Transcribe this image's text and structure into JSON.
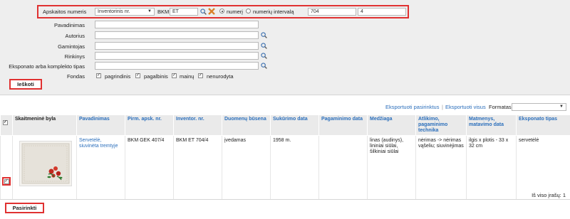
{
  "search": {
    "inventory_label": "Apskaitos numeris",
    "type_select": "Inventorinis nr.",
    "bkm_label": "BKM",
    "prefix_value": "ET",
    "radio_single": "numerį",
    "radio_interval": "numerių intervalą",
    "from_value": "704",
    "to_value": "4"
  },
  "filters": [
    {
      "label": "Pavadinimas",
      "icon": false
    },
    {
      "label": "Autorius",
      "icon": true
    },
    {
      "label": "Gamintojas",
      "icon": true
    },
    {
      "label": "Rinkinys",
      "icon": true
    },
    {
      "label": "Eksponato arba komplekto tipas",
      "icon": true
    }
  ],
  "fondas": {
    "label": "Fondas",
    "options": [
      "pagrindinis",
      "pagalbinis",
      "mainų",
      "nenurodyta"
    ]
  },
  "search_button": "Ieškoti",
  "export": {
    "selected": "Eksportuoti pasirinktus",
    "separator": "|",
    "all": "Eksportuoti visus",
    "formats_label": "Formatas"
  },
  "table": {
    "headers": [
      "Skaitmeninė byla",
      "Pavadinimas",
      "Pirm. apsk. nr.",
      "Inventor. nr.",
      "Duomenų būsena",
      "Sukūrimo data",
      "Pagaminimo data",
      "Medžiaga",
      "Atlikimo, pagaminimo technika",
      "Matmenys, matavimo data",
      "Eksponato tipas"
    ],
    "rows": [
      {
        "checked": true,
        "image_icon": "embroidered-napkin-image",
        "title": "Servetėlė, siuvinėta tremtyje",
        "first_no": "BKM GEK 407/4",
        "inv_no": "BKM ET 704/4",
        "status": "įvedamas",
        "created": "1958 m.",
        "made": "",
        "material": "linas (audinys), lininiai siūlai, šilkiniai siūlai",
        "technique": "nėrimas -> nėrimas vąšeliu; siuvinėjimas",
        "dimensions": "ilgis x plotis - 33 x 32 cm",
        "type": "servetėlė"
      }
    ]
  },
  "total_label": "Iš viso įrašų: 1",
  "select_button": "Pasirinkti",
  "colors": {
    "accent_red": "#e03131",
    "link_blue": "#2a6ebb",
    "panel_bg": "#eeeeee"
  }
}
